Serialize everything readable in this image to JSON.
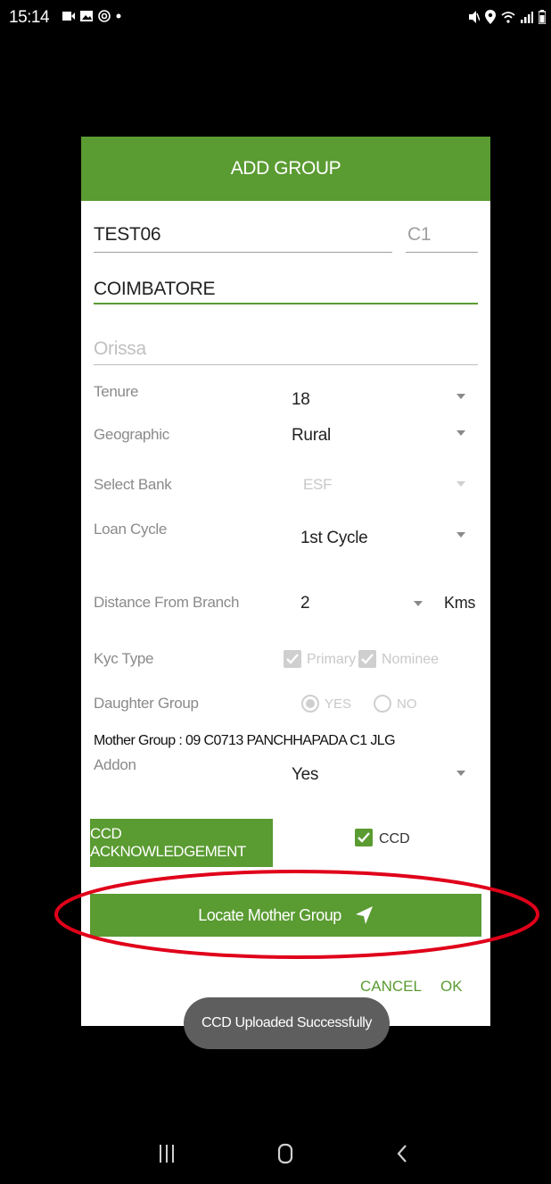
{
  "status_bar": {
    "time": "15:14"
  },
  "dialog": {
    "title": "ADD GROUP",
    "group_name": "TEST06",
    "center_code": "C1",
    "city": "COIMBATORE",
    "state_placeholder": "Orissa",
    "fields": {
      "tenure": {
        "label": "Tenure",
        "value": "18"
      },
      "geographic": {
        "label": "Geographic",
        "value": "Rural"
      },
      "bank": {
        "label": "Select Bank",
        "value": "ESF"
      },
      "loan_cycle": {
        "label": "Loan Cycle",
        "value": "1st Cycle"
      },
      "distance": {
        "label": "Distance From Branch",
        "value": "2",
        "unit": "Kms"
      },
      "kyc": {
        "label": "Kyc Type",
        "primary": "Primary",
        "nominee": "Nominee"
      },
      "daughter": {
        "label": "Daughter Group",
        "yes": "YES",
        "no": "NO"
      },
      "mother_group": "Mother Group : 09 C0713 PANCHHAPADA C1 JLG",
      "addon": {
        "label": "Addon",
        "value": "Yes"
      }
    },
    "ccd_ack_label": "CCD ACKNOWLEDGEMENT",
    "ccd_label": "CCD",
    "locate_label": "Locate Mother Group",
    "cancel_label": "CANCEL",
    "ok_label": "OK"
  },
  "toast": "CCD Uploaded Successfully",
  "colors": {
    "accent": "#5a9b32",
    "highlight": "#e0001a"
  },
  "icons": [
    "video-icon",
    "image-icon",
    "at-icon",
    "mute-icon",
    "location-icon",
    "wifi-icon",
    "signal-icon",
    "battery-icon",
    "navigation-icon",
    "recents-icon",
    "home-icon",
    "back-icon"
  ]
}
